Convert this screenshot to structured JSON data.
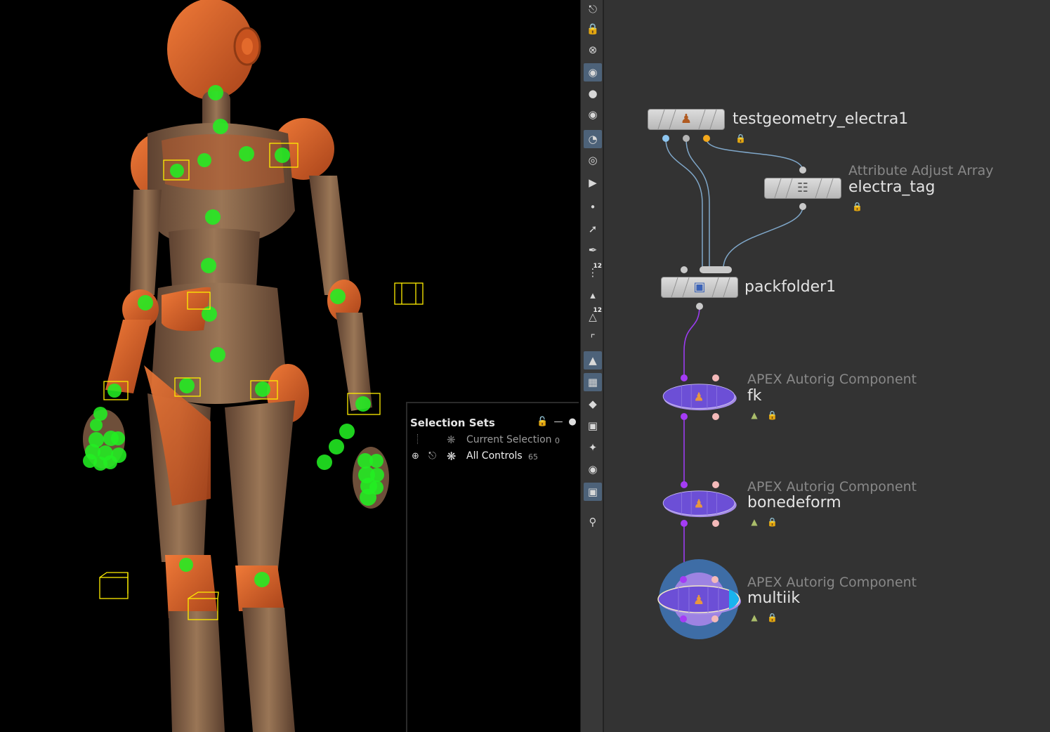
{
  "colors": {
    "viewport_bg": "#000000",
    "control_green": "#22ee22",
    "control_box_yellow": "#ffee00",
    "robot_orange": "#d85a1e",
    "robot_wood": "#8a6548",
    "network_bg": "#333333",
    "apex_purple": "#6c4fd6",
    "wire_blue": "#7fa7c9",
    "wire_purple": "#9b3cf0",
    "selected_blue": "#3e6da6"
  },
  "selection_sets": {
    "title": "Selection Sets",
    "lock_icon": "unlock-icon",
    "minimize_icon": "minus-icon",
    "options_icon": "dots-icon",
    "rows": [
      {
        "label": "Current Selection",
        "count": "0",
        "icon": "current-selection-icon"
      },
      {
        "label": "All Controls",
        "count": "65",
        "icon": "all-controls-icon"
      }
    ]
  },
  "toolbar": {
    "items": [
      {
        "icon": "view-icon"
      },
      {
        "icon": "lock-icon"
      },
      {
        "icon": "cross-icon"
      },
      {
        "icon": "display-options-icon",
        "active": true
      },
      {
        "icon": "light-bulb-icon"
      },
      {
        "icon": "headlight-icon"
      },
      {
        "icon": "shading-icon",
        "active": true
      },
      {
        "icon": "ghost-icon"
      },
      {
        "icon": "flipbook-icon"
      },
      {
        "icon": "point-icon"
      },
      {
        "icon": "brush-icon"
      },
      {
        "icon": "pen-icon"
      },
      {
        "icon": "point-numbers-icon",
        "badge": "12"
      },
      {
        "icon": "normals-icon"
      },
      {
        "icon": "primitive-numbers-icon",
        "badge": "12"
      },
      {
        "icon": "measure-icon"
      },
      {
        "icon": "templated-icon",
        "active": true
      },
      {
        "icon": "checker-icon",
        "active": true
      },
      {
        "icon": "diamond-icon"
      },
      {
        "icon": "guide-icon"
      },
      {
        "icon": "snap-icon"
      },
      {
        "icon": "toggle-icon"
      },
      {
        "icon": "background-image-icon",
        "active": true
      },
      {
        "icon": "pin-icon"
      }
    ]
  },
  "network": {
    "nodes": [
      {
        "id": "testgeometry",
        "name": "testgeometry_electra1",
        "type": "",
        "icon": "human-figure-icon"
      },
      {
        "id": "electra_tag",
        "name": "electra_tag",
        "type": "Attribute Adjust Array",
        "icon": "attribute-array-icon"
      },
      {
        "id": "packfolder",
        "name": "packfolder1",
        "type": "",
        "icon": "packfolder-icon"
      },
      {
        "id": "fk",
        "name": "fk",
        "type": "APEX Autorig Component",
        "icon": "apex-figure-icon"
      },
      {
        "id": "bonedeform",
        "name": "bonedeform",
        "type": "APEX Autorig Component",
        "icon": "apex-figure-icon"
      },
      {
        "id": "multiik",
        "name": "multiik",
        "type": "APEX Autorig Component",
        "icon": "apex-figure-icon",
        "selected": true
      }
    ]
  }
}
